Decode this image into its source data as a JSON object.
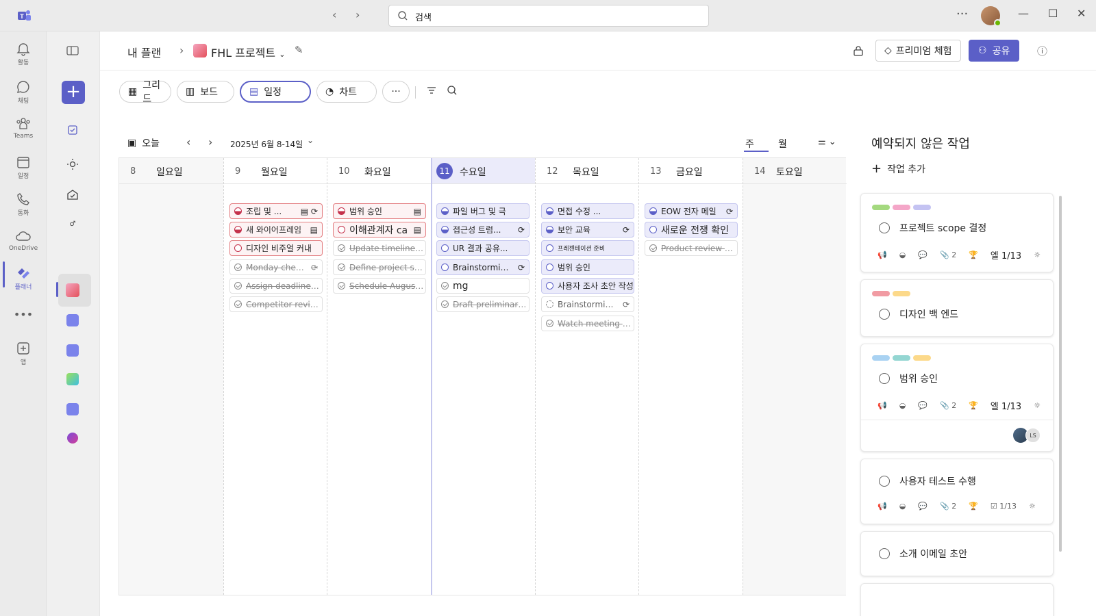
{
  "titlebar": {
    "search_placeholder": "검색"
  },
  "rail": [
    {
      "label": "활동",
      "icon": "bell-icon"
    },
    {
      "label": "채팅",
      "icon": "chat-icon"
    },
    {
      "label": "Teams",
      "icon": "teams-icon"
    },
    {
      "label": "일정",
      "icon": "calendar-icon"
    },
    {
      "label": "통화",
      "icon": "phone-icon"
    },
    {
      "label": "OneDrive",
      "icon": "cloud-icon"
    },
    {
      "label": "플래너",
      "icon": "planner-icon"
    },
    {
      "label": "앱",
      "icon": "apps-add-icon"
    }
  ],
  "header": {
    "crumb_root": "내 플랜",
    "project_name": "FHL 프로젝트",
    "premium_label": "프리미엄 체험",
    "share_label": "공유"
  },
  "tabs": [
    {
      "label": "그리드",
      "icon": "grid-icon"
    },
    {
      "label": "보드",
      "icon": "board-icon"
    },
    {
      "label": "일정",
      "icon": "schedule-icon"
    },
    {
      "label": "차트",
      "icon": "chart-icon"
    }
  ],
  "calendar": {
    "today_label": "오늘",
    "range_label": "2025년 6월 8-14일",
    "week_label": "주",
    "month_label": "월",
    "days": [
      {
        "num": "8",
        "name": "일요일"
      },
      {
        "num": "9",
        "name": "월요일"
      },
      {
        "num": "10",
        "name": "화요일"
      },
      {
        "num": "11",
        "name": "수요일"
      },
      {
        "num": "12",
        "name": "목요일"
      },
      {
        "num": "13",
        "name": "금요일"
      },
      {
        "num": "14",
        "name": "토요일"
      }
    ],
    "tasks": {
      "mon": [
        "조립 및 ...",
        "새 와이어프레임",
        "디자인 비주얼 커내",
        "Monday check-...",
        "Assign deadlines a...",
        "Competitor review..."
      ],
      "tue": [
        "범위 승인",
        "이해관계자 ca",
        "Update timelines f...",
        "Define project stru...",
        "Schedule August d..."
      ],
      "wed": [
        "파일 버그 및 극",
        "접근성 트럼...",
        "UR 결과 공유...",
        "Brainstorming...",
        "mg",
        "Draft preliminary s..."
      ],
      "thu": [
        "면접 수정 ...",
        "보안 교육",
        "프레젠테이션 준비",
        "범위 승인",
        "사용자 조사 초안 작성",
        "Brainstorming...",
        "Watch meeting rec..."
      ],
      "fri": [
        "EOW 전자 메일",
        "새로운 전쟁 확인",
        "Product review deck"
      ]
    }
  },
  "unscheduled": {
    "title": "예약되지 않은 작업",
    "add_label": "작업 추가",
    "cards": [
      {
        "title": "프로젝트 scope 결정",
        "attach": "2",
        "date": "엘 1/13",
        "labels": [
          "#a4d97f",
          "#f4a6c8",
          "#c4c3f2"
        ]
      },
      {
        "title": "디자인 백 엔드",
        "labels": [
          "#f19ba3",
          "#fcd98a"
        ]
      },
      {
        "title": "범위 승인",
        "attach": "2",
        "date": "엘 1/13",
        "avatar_initials": "LS",
        "labels": [
          "#a9d2f2",
          "#94d6d2",
          "#fcd98a"
        ]
      },
      {
        "title": "사용자 테스트 수행",
        "attach": "2",
        "checklist": "1/13"
      },
      {
        "title": "소개 이메일 초안"
      }
    ]
  },
  "colors": {
    "accent": "#5b5fc7",
    "urgent": "#c4314b"
  }
}
